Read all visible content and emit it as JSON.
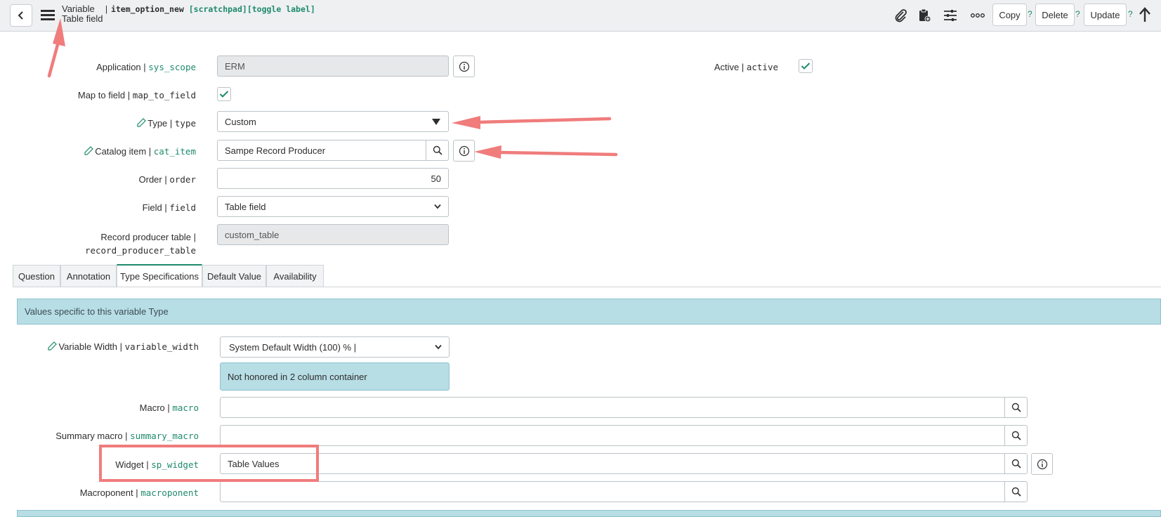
{
  "header": {
    "title_line1": "Variable",
    "title_line2": "Table field",
    "record_separator": "|",
    "record_name": "item_option_new",
    "record_tags": "[scratchpad][toggle label]",
    "copy_label": "Copy",
    "delete_label": "Delete",
    "update_label": "Update",
    "help_mark": "?"
  },
  "form": {
    "application": {
      "label": "Application | ",
      "field": "sys_scope",
      "value": "ERM"
    },
    "active": {
      "label": "Active | ",
      "field": "active",
      "checked": true
    },
    "map_to_field": {
      "label": "Map to field | ",
      "field": "map_to_field",
      "checked": true
    },
    "type": {
      "label": "Type | ",
      "field": "type",
      "value": "Custom"
    },
    "catalog_item": {
      "label": "Catalog item | ",
      "field": "cat_item",
      "value": "Sampe Record Producer"
    },
    "order": {
      "label": "Order | ",
      "field": "order",
      "value": "50"
    },
    "field": {
      "label": "Field | ",
      "field": "field",
      "value": "Table field"
    },
    "record_producer_table": {
      "label": "Record producer table |",
      "field": "record_producer_table",
      "value": "custom_table"
    }
  },
  "tabs": [
    {
      "label": "Question"
    },
    {
      "label": "Annotation"
    },
    {
      "label": "Type Specifications",
      "active": true
    },
    {
      "label": "Default Value"
    },
    {
      "label": "Availability"
    }
  ],
  "type_spec": {
    "banner": "Values specific to this variable Type",
    "variable_width": {
      "label": "Variable Width | ",
      "field": "variable_width",
      "value": "System Default Width (100) % |"
    },
    "note": "Not honored in 2 column container",
    "macro": {
      "label": "Macro | ",
      "field": "macro",
      "value": ""
    },
    "summary_macro": {
      "label": "Summary macro | ",
      "field": "summary_macro",
      "value": ""
    },
    "widget": {
      "label": "Widget | ",
      "field": "sp_widget",
      "value": "Table Values"
    },
    "macroponent": {
      "label": "Macroponent | ",
      "field": "macroponent",
      "value": ""
    }
  },
  "colors": {
    "accent": "#1f8a6c",
    "annotation": "#f07c7c",
    "banner": "#b7dde5"
  }
}
